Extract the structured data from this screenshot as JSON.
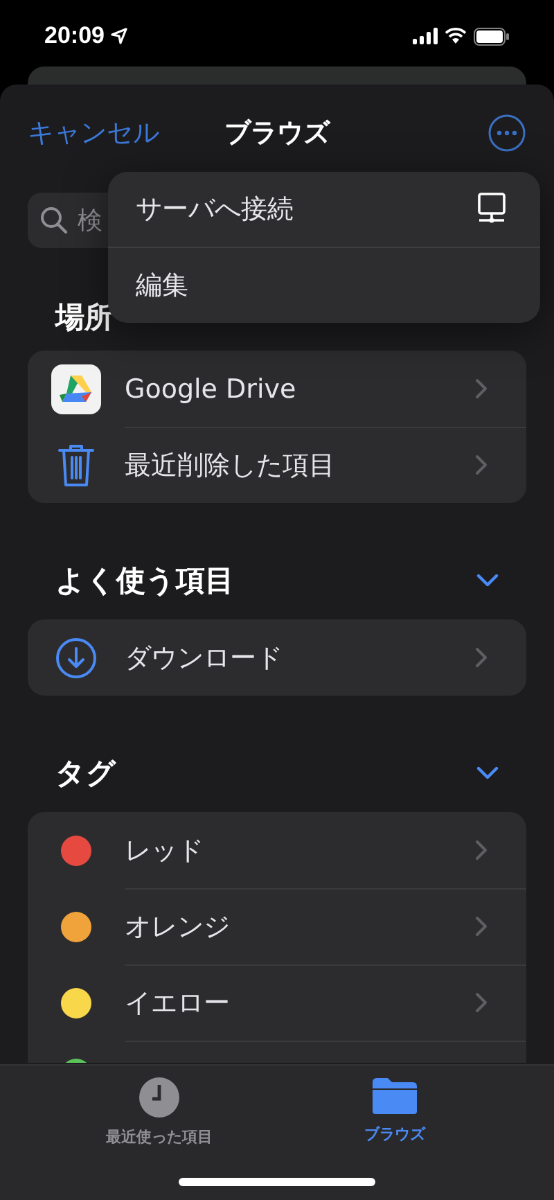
{
  "status_bar": {
    "time": "20:09"
  },
  "nav": {
    "cancel": "キャンセル",
    "title": "ブラウズ"
  },
  "search": {
    "placeholder": "検"
  },
  "menu": [
    {
      "label": "サーバへ接続",
      "kind": "server"
    },
    {
      "label": "編集",
      "kind": "plain"
    }
  ],
  "locations": {
    "title": "場所",
    "items": [
      {
        "label": "Google Drive",
        "kind": "drive"
      },
      {
        "label": "最近削除した項目",
        "kind": "trash"
      }
    ]
  },
  "favorites": {
    "title": "よく使う項目",
    "expanded": true,
    "items": [
      {
        "label": "ダウンロード",
        "kind": "download"
      }
    ]
  },
  "tags": {
    "title": "タグ",
    "expanded": true,
    "items": [
      {
        "label": "レッド",
        "color": "#e5493f"
      },
      {
        "label": "オレンジ",
        "color": "#f0a23b"
      },
      {
        "label": "イエロー",
        "color": "#f8d74a"
      },
      {
        "color": "#5bc35a"
      }
    ]
  },
  "tab_bar": [
    {
      "label": "最近使った項目",
      "kind": "recent",
      "selected": false
    },
    {
      "label": "ブラウズ",
      "kind": "browse",
      "selected": true
    }
  ]
}
